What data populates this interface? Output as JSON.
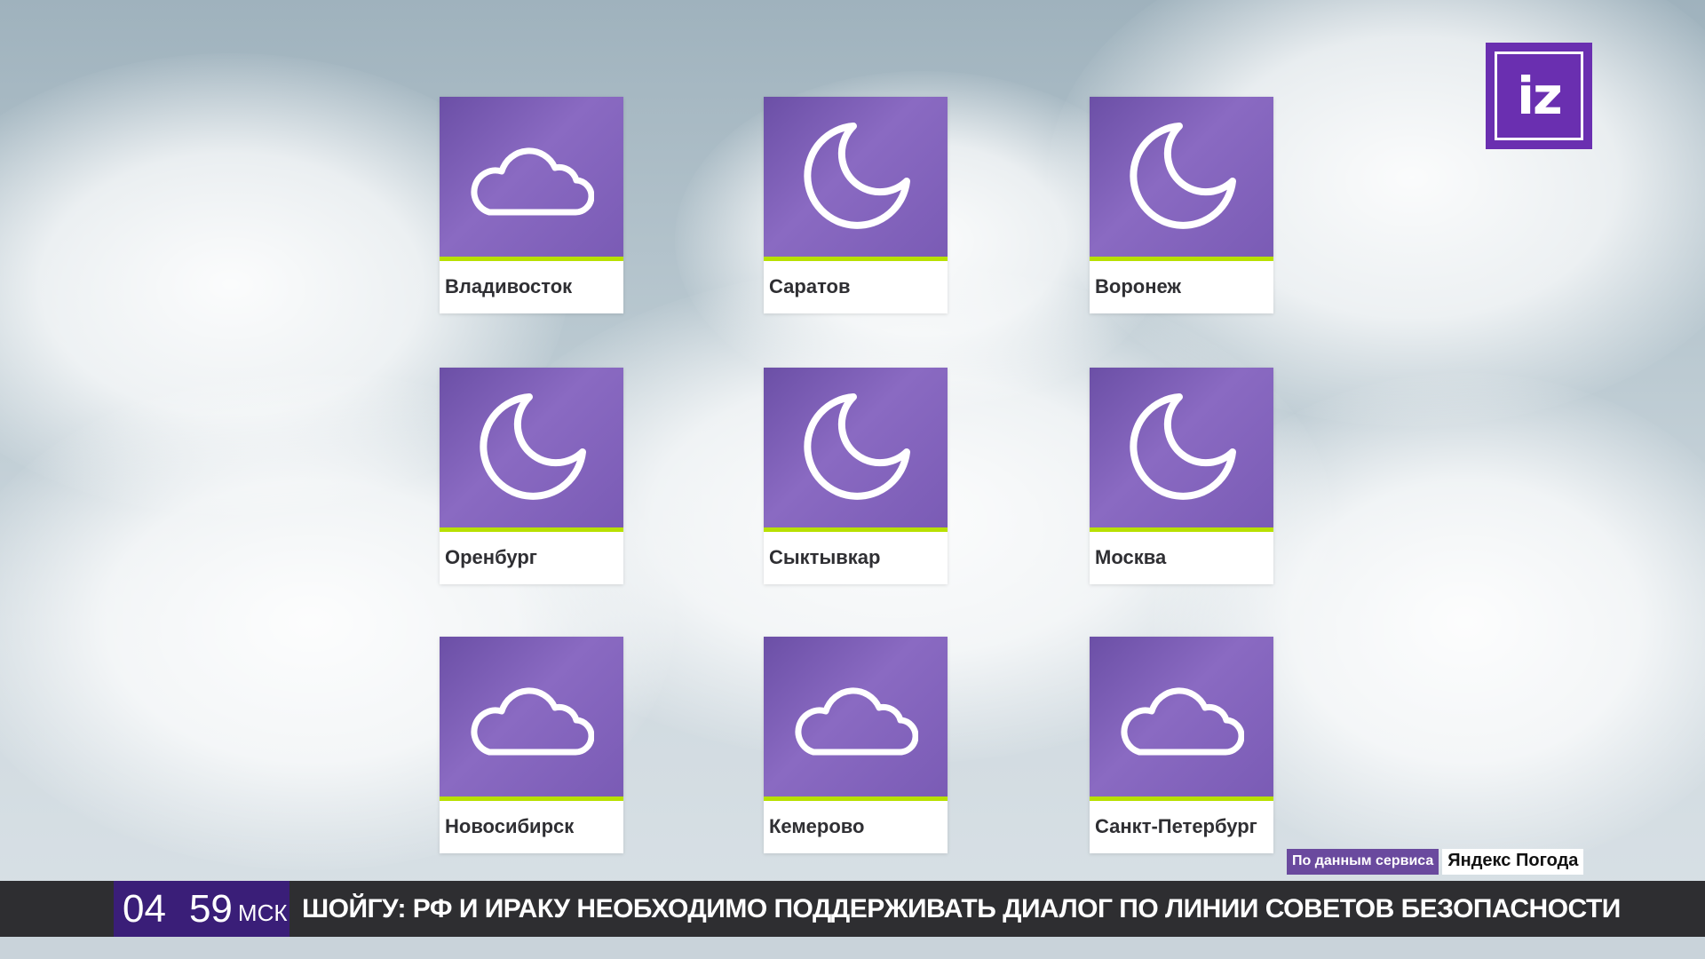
{
  "logo": {
    "text": "iz",
    "color": "#6a2fb0"
  },
  "cities": [
    {
      "name": "Владивосток",
      "icon": "cloud-icon"
    },
    {
      "name": "Саратов",
      "icon": "moon-icon"
    },
    {
      "name": "Воронеж",
      "icon": "moon-icon"
    },
    {
      "name": "Оренбург",
      "icon": "moon-icon"
    },
    {
      "name": "Сыктывкар",
      "icon": "moon-icon"
    },
    {
      "name": "Москва",
      "icon": "moon-icon"
    },
    {
      "name": "Новосибирск",
      "icon": "cloud-icon"
    },
    {
      "name": "Кемерово",
      "icon": "cloud-icon"
    },
    {
      "name": "Санкт-Петербург",
      "icon": "cloud-icon"
    }
  ],
  "source": {
    "prefix": "По данным сервиса",
    "service": "Яндекс Погода"
  },
  "ticker": {
    "hours": "04",
    "minutes": "59",
    "timezone": "МСК",
    "headline": "ШОЙГУ: РФ И ИРАКУ НЕОБХОДИМО ПОДДЕРЖИВАТЬ ДИАЛОГ ПО ЛИНИИ СОВЕТОВ БЕЗОПАСНОСТИ"
  },
  "colors": {
    "tile": "#7a5bb5",
    "accent": "#b8e000",
    "clock_bg": "#3a1e78",
    "ticker_bg": "#2e2e31"
  }
}
